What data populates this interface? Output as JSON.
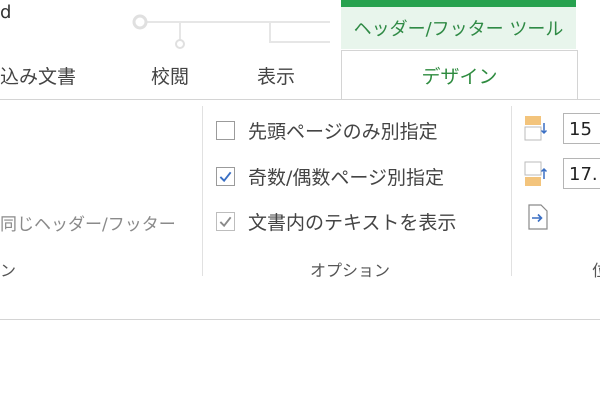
{
  "window": {
    "title_fragment": "d"
  },
  "tool_context": {
    "label": "ヘッダー/フッター ツール",
    "accent": "#27a24f"
  },
  "tabs": [
    {
      "label": "込み文書"
    },
    {
      "label": "校閲"
    },
    {
      "label": "表示"
    },
    {
      "label": "デザイン",
      "active": true
    }
  ],
  "ribbon": {
    "left_group": {
      "item_label": "同じヘッダー/フッター",
      "group_label": "ン"
    },
    "options": {
      "items": [
        {
          "label": "先頭ページのみ別指定",
          "checked": false,
          "enabled": true
        },
        {
          "label": "奇数/偶数ページ別指定",
          "checked": true,
          "enabled": true
        },
        {
          "label": "文書内のテキストを表示",
          "checked": true,
          "enabled": false
        }
      ],
      "group_label": "オプション"
    },
    "position": {
      "header_top": "15",
      "footer_bottom": "17.",
      "group_label": "位"
    }
  },
  "colors": {
    "active_tab": "#2e8b3f",
    "tool_bg": "#e8f5ec",
    "check": "#3a6fc4"
  }
}
